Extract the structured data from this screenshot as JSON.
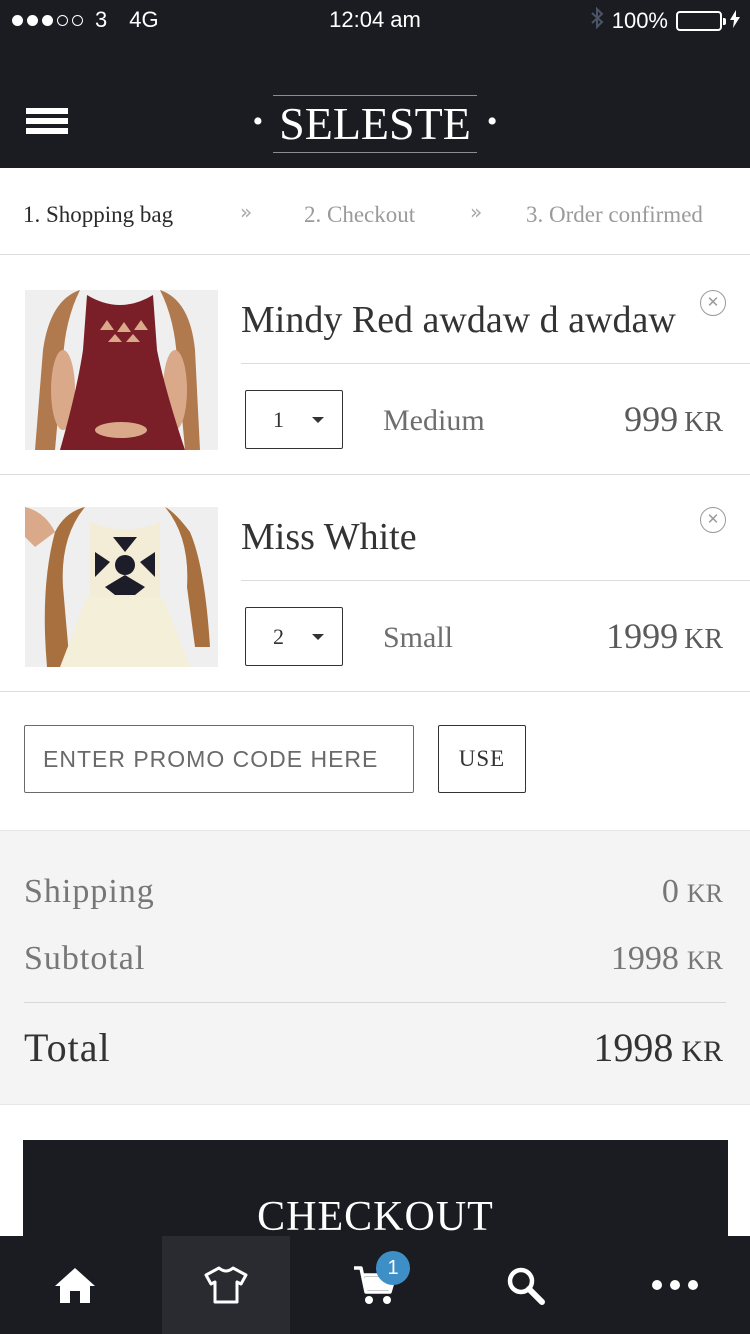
{
  "status_bar": {
    "carrier": "3",
    "network": "4G",
    "time": "12:04 am",
    "battery": "100%"
  },
  "header": {
    "logo": "SELESTE",
    "menu_icon": "hamburger-menu-icon"
  },
  "steps": [
    {
      "label": "1. Shopping bag",
      "active": true
    },
    {
      "label": "2. Checkout",
      "active": false
    },
    {
      "label": "3. Order confirmed",
      "active": false
    }
  ],
  "step_separator": "»",
  "cart": {
    "items": [
      {
        "name": "Mindy Red awdaw d awdaw",
        "quantity": "1",
        "size": "Medium",
        "price": "999",
        "currency": "KR"
      },
      {
        "name": "Miss White",
        "quantity": "2",
        "size": "Small",
        "price": "1999",
        "currency": "KR"
      }
    ]
  },
  "promo": {
    "placeholder": "ENTER PROMO CODE HERE",
    "button": "USE"
  },
  "totals": {
    "shipping_label": "Shipping",
    "shipping_value": "0",
    "subtotal_label": "Subtotal",
    "subtotal_value": "1998",
    "total_label": "Total",
    "total_value": "1998",
    "currency": "KR"
  },
  "checkout_button": "CHECKOUT",
  "tabbar": {
    "tabs": [
      "home-icon",
      "shirt-icon",
      "cart-icon",
      "search-icon",
      "more-icon"
    ],
    "cart_badge": "1"
  },
  "colors": {
    "dark": "#1b1c21",
    "badge": "#3f8fc7",
    "panel": "#f4f4f4"
  }
}
